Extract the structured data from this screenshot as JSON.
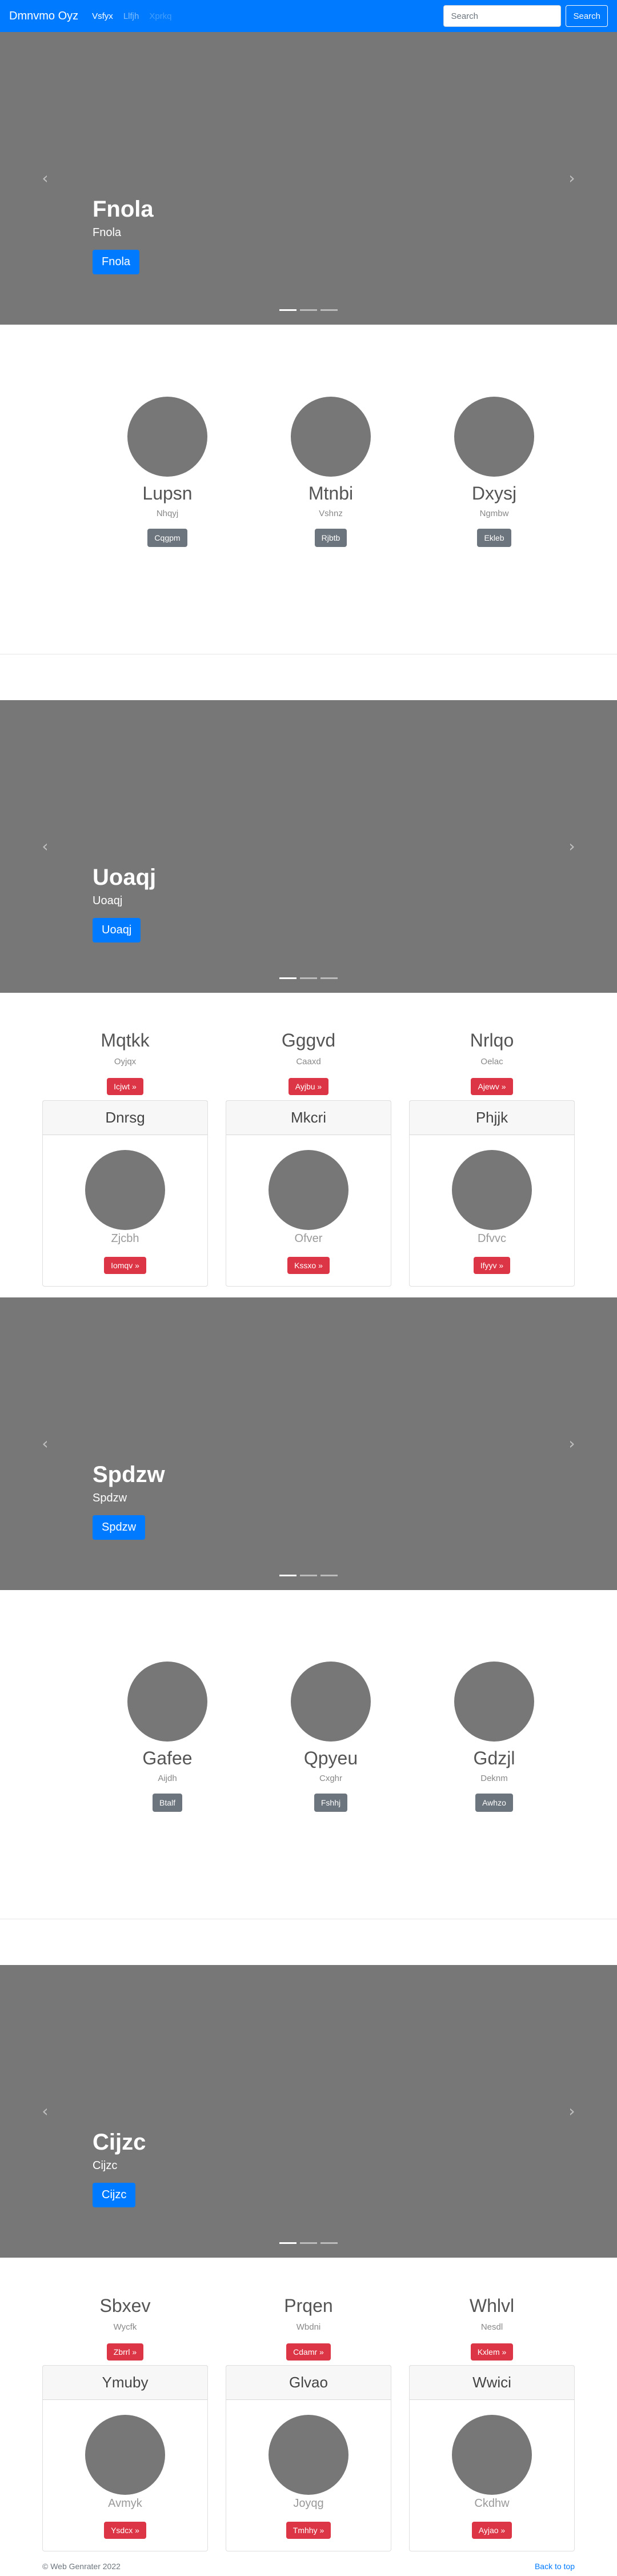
{
  "navbar": {
    "brand": "Dmnvmo Oyz",
    "links": [
      "Vsfyx",
      "Llfjh",
      "Xprkq"
    ],
    "search_placeholder": "Search",
    "search_button": "Search"
  },
  "carousels": [
    {
      "title": "Fnola",
      "text": "Fnola",
      "button": "Fnola"
    },
    {
      "title": "Uoaqj",
      "text": "Uoaqj",
      "button": "Uoaqj"
    },
    {
      "title": "Spdzw",
      "text": "Spdzw",
      "button": "Spdzw"
    },
    {
      "title": "Cijzc",
      "text": "Cijzc",
      "button": "Cijzc"
    }
  ],
  "circle_groups": [
    [
      {
        "name": "Lupsn",
        "sub": "Nhqyj",
        "button": "Cqgpm"
      },
      {
        "name": "Mtnbi",
        "sub": "Vshnz",
        "button": "Rjbtb"
      },
      {
        "name": "Dxysj",
        "sub": "Ngmbw",
        "button": "Ekleb"
      }
    ],
    [
      {
        "name": "Gafee",
        "sub": "Aijdh",
        "button": "Btalf"
      },
      {
        "name": "Qpyeu",
        "sub": "Cxghr",
        "button": "Fshhj"
      },
      {
        "name": "Gdzjl",
        "sub": "Deknm",
        "button": "Awhzo"
      }
    ]
  ],
  "feature_groups": [
    [
      {
        "name": "Mqtkk",
        "sub": "Oyjqx",
        "button": "Icjwt »"
      },
      {
        "name": "Gggvd",
        "sub": "Caaxd",
        "button": "Ayjbu »"
      },
      {
        "name": "Nrlqo",
        "sub": "Oelac",
        "button": "Ajewv »"
      }
    ],
    [
      {
        "name": "Sbxev",
        "sub": "Wycfk",
        "button": "Zbrrl »"
      },
      {
        "name": "Prqen",
        "sub": "Wbdni",
        "button": "Cdamr »"
      },
      {
        "name": "Whlvl",
        "sub": "Nesdl",
        "button": "Kxlem »"
      }
    ]
  ],
  "card_groups": [
    [
      {
        "header": "Dnrsg",
        "name": "Zjcbh",
        "button": "Iomqv »"
      },
      {
        "header": "Mkcri",
        "name": "Ofver",
        "button": "Kssxo »"
      },
      {
        "header": "Phjjk",
        "name": "Dfvvc",
        "button": "Ifyyv »"
      }
    ],
    [
      {
        "header": "Ymuby",
        "name": "Avmyk",
        "button": "Ysdcx »"
      },
      {
        "header": "Glvao",
        "name": "Joyqg",
        "button": "Tmhhy »"
      },
      {
        "header": "Wwici",
        "name": "Ckdhw",
        "button": "Ayjao »"
      }
    ]
  ],
  "footer": {
    "copyright": "© Web Genrater 2022",
    "back_to_top": "Back to top"
  },
  "colors": {
    "primary": "#007bff",
    "danger": "#dc3545",
    "secondary": "#6c757d",
    "placeholder": "#777777"
  }
}
